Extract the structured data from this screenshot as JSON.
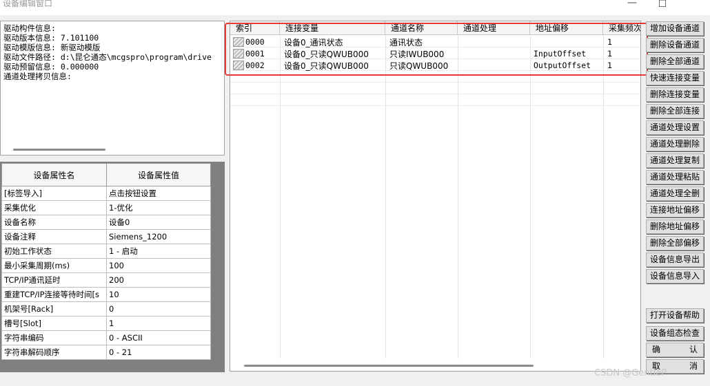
{
  "window": {
    "title": "设备编辑窗口",
    "minimize": "—",
    "maximize": "☐"
  },
  "info": {
    "lines": [
      "驱动构件信息:",
      "驱动版本信息: 7.101100",
      "驱动模版信息: 新驱动模版",
      "驱动文件路径: d:\\昆仑通态\\mcgspro\\program\\drive",
      "驱动预留信息: 0.000000",
      "通道处理拷贝信息:"
    ]
  },
  "properties": {
    "header_name": "设备属性名",
    "header_value": "设备属性值",
    "rows": [
      {
        "name": "[标签导入]",
        "value": "点击按钮设置"
      },
      {
        "name": "采集优化",
        "value": "1-优化"
      },
      {
        "name": "设备名称",
        "value": "设备0"
      },
      {
        "name": "设备注释",
        "value": "Siemens_1200"
      },
      {
        "name": "初始工作状态",
        "value": "1 - 启动"
      },
      {
        "name": "最小采集周期(ms)",
        "value": "100"
      },
      {
        "name": "TCP/IP通讯延时",
        "value": "200"
      },
      {
        "name": "重建TCP/IP连接等待时间[s",
        "value": "10"
      },
      {
        "name": "机架号[Rack]",
        "value": "0"
      },
      {
        "name": "槽号[Slot]",
        "value": "1"
      },
      {
        "name": "字符串编码",
        "value": "0 - ASCII"
      },
      {
        "name": "字符串解码顺序",
        "value": "0 - 21"
      }
    ]
  },
  "grid": {
    "columns": [
      "索引",
      "连接变量",
      "通道名称",
      "通道处理",
      "地址偏移",
      "采集频次"
    ],
    "rows": [
      {
        "index": "0000",
        "variable": "设备0_通讯状态",
        "channel": "通讯状态",
        "process": "",
        "offset": "",
        "freq": "1"
      },
      {
        "index": "0001",
        "variable": "设备0_只读QWUB000",
        "channel": "只读IWUB000",
        "process": "",
        "offset": "InputOffset",
        "freq": "1"
      },
      {
        "index": "0002",
        "variable": "设备0_只读QWUB000",
        "channel": "只读QWUB000",
        "process": "",
        "offset": "OutputOffset",
        "freq": "1"
      }
    ]
  },
  "buttons": {
    "add_channel": "增加设备通道",
    "delete_channel": "删除设备通道",
    "delete_all_channels": "删除全部通道",
    "quick_connect": "快速连接变量",
    "delete_connect": "删除连接变量",
    "delete_all_connect": "删除全部连接",
    "process_set": "通道处理设置",
    "process_delete": "通道处理删除",
    "process_copy": "通道处理复制",
    "process_paste": "通道处理粘贴",
    "process_delete_all": "通道处理全删",
    "connect_offset": "连接地址偏移",
    "delete_offset": "删除地址偏移",
    "delete_all_offset": "删除全部偏移",
    "export_info": "设备信息导出",
    "import_info": "设备信息导入",
    "open_help": "打开设备帮助",
    "check_config": "设备组态检查",
    "ok_left": "确",
    "ok_right": "认",
    "cancel_left": "取",
    "cancel_right": "消"
  },
  "watermark": "CSDN @GentleP"
}
